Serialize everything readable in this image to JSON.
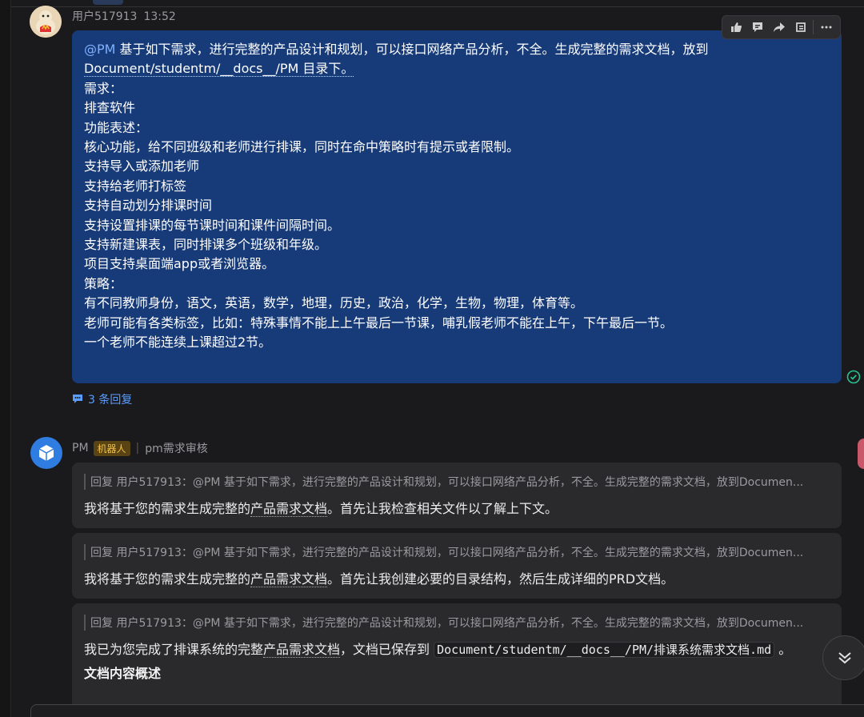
{
  "user_message": {
    "sender": "用户517913",
    "time": "13:52",
    "mention": "@PM",
    "lines": [
      "基于如下需求，进行完整的产品设计和规划，可以接口网络产品分析，不全。生成完整的需求文档，放到",
      "Document/studentm/__docs__/PM 目录下。",
      "需求：",
      "排查软件",
      "",
      "功能表述：",
      "核心功能，给不同班级和老师进行排课，同时在命中策略时有提示或者限制。",
      "支持导入或添加老师",
      "支持给老师打标签",
      "支持自动划分排课时间",
      "支持设置排课的每节课时间和课件间隔时间。",
      "支持新建课表，同时排课多个班级和年级。",
      "项目支持桌面端app或者浏览器。",
      "策略：",
      "有不同教师身份，语文，英语，数学，地理，历史，政治，化学，生物，物理，体育等。",
      "老师可能有各类标签，比如：特殊事情不能上上午最后一节课，哺乳假老师不能在上午，下午最后一节。",
      "一个老师不能连续上课超过2节。"
    ],
    "replies_label": "3 条回复"
  },
  "bot": {
    "name": "PM",
    "badge": "机器人",
    "channel": "pm需求审核",
    "quote": "回复 用户517913：@PM 基于如下需求，进行完整的产品设计和规划，可以接口网络产品分析，不全。生成完整的需求文档，放到Documen...",
    "replies": [
      {
        "pre": "我将基于您的需求生成完整的",
        "link": "产品需求文档",
        "post": "。首先让我检查相关文件以了解上下文。"
      },
      {
        "pre": "我将基于您的需求生成完整的",
        "link": "产品需求文档",
        "post": "。首先让我创建必要的目录结构，然后生成详细的PRD文档。"
      },
      {
        "pre": "我已为您完成了排课系统的完整",
        "link": "产品需求文档",
        "post": "，文档已保存到 ",
        "code": "Document/studentm/__docs__/PM/排课系统需求文档.md",
        "tail": " 。",
        "heading": "文档内容概述"
      }
    ]
  },
  "colors": {
    "bubble": "#173a78",
    "accent": "#5b9cff",
    "bg": "#1a1a1c"
  }
}
